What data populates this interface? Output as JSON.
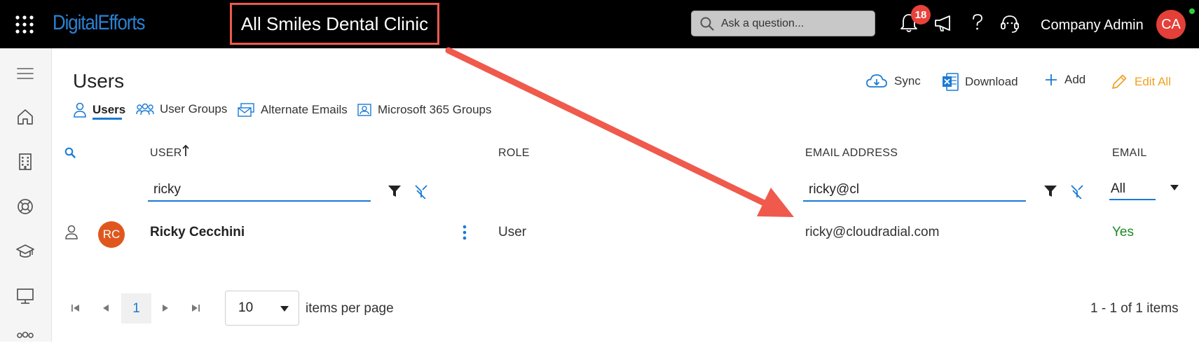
{
  "app": {
    "logo": "DigitalEfforts",
    "tenant": "All Smiles Dental Clinic",
    "search_placeholder": "Ask a question...",
    "notifications_count": "18",
    "user_name": "Company Admin",
    "user_initials": "CA"
  },
  "page": {
    "title": "Users",
    "actions": {
      "sync": "Sync",
      "download": "Download",
      "add": "Add",
      "edit_all": "Edit All"
    },
    "tabs": [
      {
        "label": "Users",
        "icon": "person-icon",
        "active": true
      },
      {
        "label": "User Groups",
        "icon": "people-icon",
        "active": false
      },
      {
        "label": "Alternate Emails",
        "icon": "mail-alternate-icon",
        "active": false
      },
      {
        "label": "Microsoft 365 Groups",
        "icon": "group-box-icon",
        "active": false
      }
    ]
  },
  "table": {
    "columns": {
      "user": "USER",
      "role": "ROLE",
      "email_address": "EMAIL ADDRESS",
      "email": "EMAIL"
    },
    "filters": {
      "user": "ricky",
      "email_address": "ricky@cl",
      "email": "All"
    },
    "rows": [
      {
        "initials": "RC",
        "name": "Ricky Cecchini",
        "role": "User",
        "email_address": "ricky@cloudradial.com",
        "email": "Yes"
      }
    ]
  },
  "pagination": {
    "current_page": "1",
    "page_size": "10",
    "page_size_label": "items per page",
    "summary": "1 - 1 of 1 items"
  },
  "colors": {
    "accent": "#1a7ad4",
    "highlight_box": "#ef5a4c",
    "arrow": "#ef5a4c",
    "edit_all": "#f0a020",
    "yes": "#1d8a23",
    "row_avatar": "#e0571e",
    "user_avatar": "#e43f38"
  }
}
